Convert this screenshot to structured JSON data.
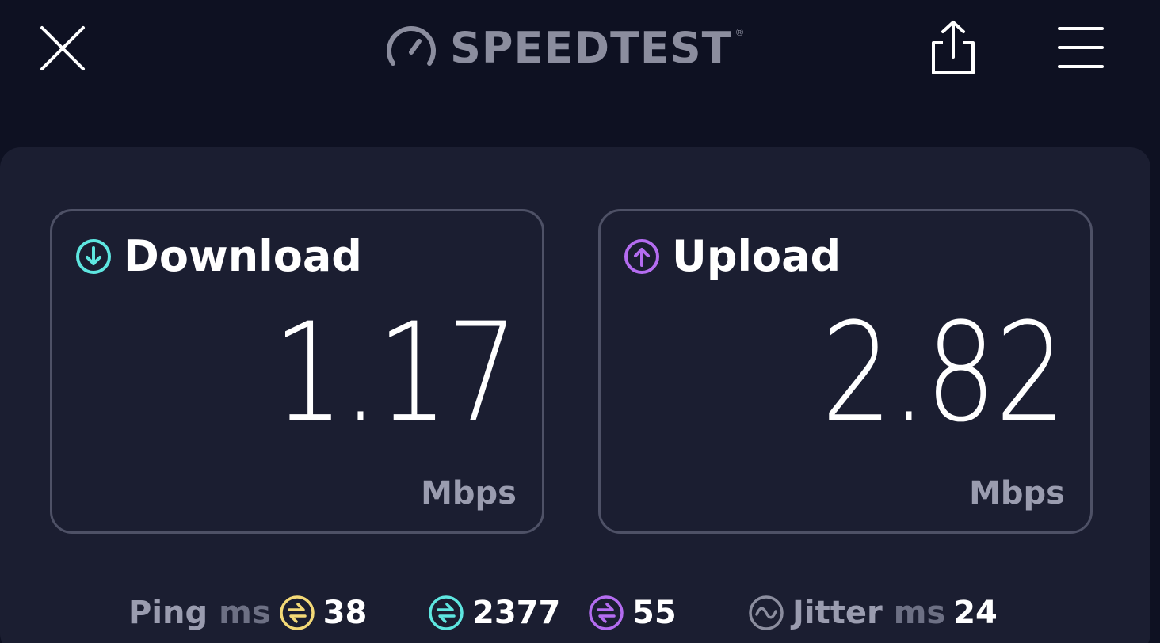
{
  "header": {
    "logo_text": "SPEEDTEST",
    "logo_mark": "®",
    "icons": {
      "close": "close-icon",
      "logo": "speedometer-icon",
      "share": "share-icon",
      "menu": "hamburger-menu-icon"
    }
  },
  "download": {
    "title": "Download",
    "value": "1.17",
    "unit": "Mbps",
    "icon": "arrow-down-circle-icon",
    "accent": "#5ee6e0"
  },
  "upload": {
    "title": "Upload",
    "value": "2.82",
    "unit": "Mbps",
    "icon": "arrow-up-circle-icon",
    "accent": "#b46cf0"
  },
  "stats": {
    "ping_label": "Ping",
    "ping_unit": "ms",
    "idle_ping": "38",
    "idle_ping_color": "#f3d977",
    "download_ping": "2377",
    "download_ping_color": "#5ee6e0",
    "upload_ping": "55",
    "upload_ping_color": "#b46cf0",
    "jitter_label": "Jitter",
    "jitter_unit": "ms",
    "jitter": "24"
  },
  "colors": {
    "background": "#0e1122",
    "panel": "#1b1e31",
    "card_border": "#4e5166",
    "muted_text": "#9a9caf"
  }
}
